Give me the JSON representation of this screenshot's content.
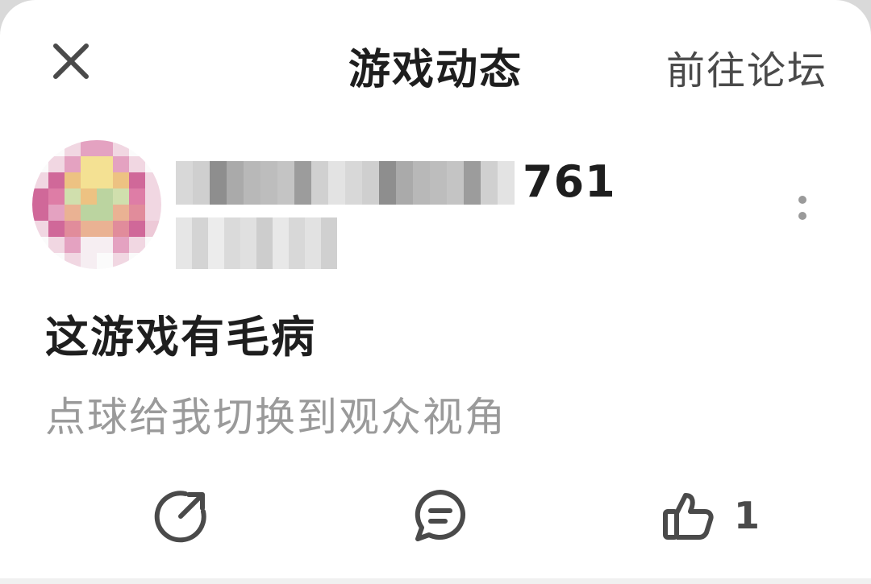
{
  "header": {
    "close_icon": "close-icon",
    "title": "游戏动态",
    "forum_link": "前往论坛"
  },
  "post": {
    "author": {
      "name_visible_suffix": "761",
      "avatar": "pixelated-avatar",
      "more_icon": "more-vertical-icon"
    },
    "title": "这游戏有毛病",
    "body": "点球给我切换到观众视角"
  },
  "actions": {
    "share_icon": "share-icon",
    "comment_icon": "comment-icon",
    "like_icon": "thumbs-up-icon",
    "like_count": "1"
  },
  "colors": {
    "text_primary": "#1e1e1e",
    "text_secondary": "#9a9a9a",
    "icon": "#4a4a4a"
  }
}
